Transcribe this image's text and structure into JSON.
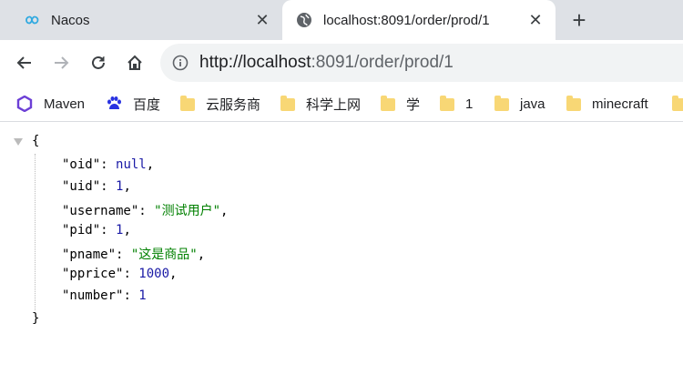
{
  "tabs": [
    {
      "title": "Nacos",
      "active": false,
      "icon": "nacos-logo-icon"
    },
    {
      "title": "localhost:8091/order/prod/1",
      "active": true,
      "icon": "globe-icon"
    }
  ],
  "toolbar": {
    "url_host": "http://localhost",
    "url_rest": ":8091/order/prod/1"
  },
  "bookmarks": [
    {
      "label": "Maven",
      "icon": "maven-logo-icon"
    },
    {
      "label": "百度",
      "icon": "baidu-paw-icon"
    },
    {
      "label": "云服务商",
      "icon": "folder-icon"
    },
    {
      "label": "科学上网",
      "icon": "folder-icon"
    },
    {
      "label": "学",
      "icon": "folder-icon"
    },
    {
      "label": "1",
      "icon": "folder-icon"
    },
    {
      "label": "java",
      "icon": "folder-icon"
    },
    {
      "label": "minecraft",
      "icon": "folder-icon"
    }
  ],
  "json_view": {
    "open_brace": "{",
    "close_brace": "}",
    "entries": [
      {
        "key": "\"oid\"",
        "sep": ": ",
        "value": "null",
        "comma": ","
      },
      {
        "key": "\"uid\"",
        "sep": ": ",
        "value": "1",
        "comma": ","
      },
      {
        "key": "\"username\"",
        "sep": ": ",
        "value": "\"测试用户\"",
        "comma": ","
      },
      {
        "key": "\"pid\"",
        "sep": ": ",
        "value": "1",
        "comma": ","
      },
      {
        "key": "\"pname\"",
        "sep": ": ",
        "value": "\"这是商品\"",
        "comma": ","
      },
      {
        "key": "\"pprice\"",
        "sep": ": ",
        "value": "1000",
        "comma": ","
      },
      {
        "key": "\"number\"",
        "sep": ": ",
        "value": "1",
        "comma": ""
      }
    ]
  },
  "colors": {
    "number": "#1a1aa6",
    "string": "#008000",
    "null": "#1a1aa6"
  }
}
